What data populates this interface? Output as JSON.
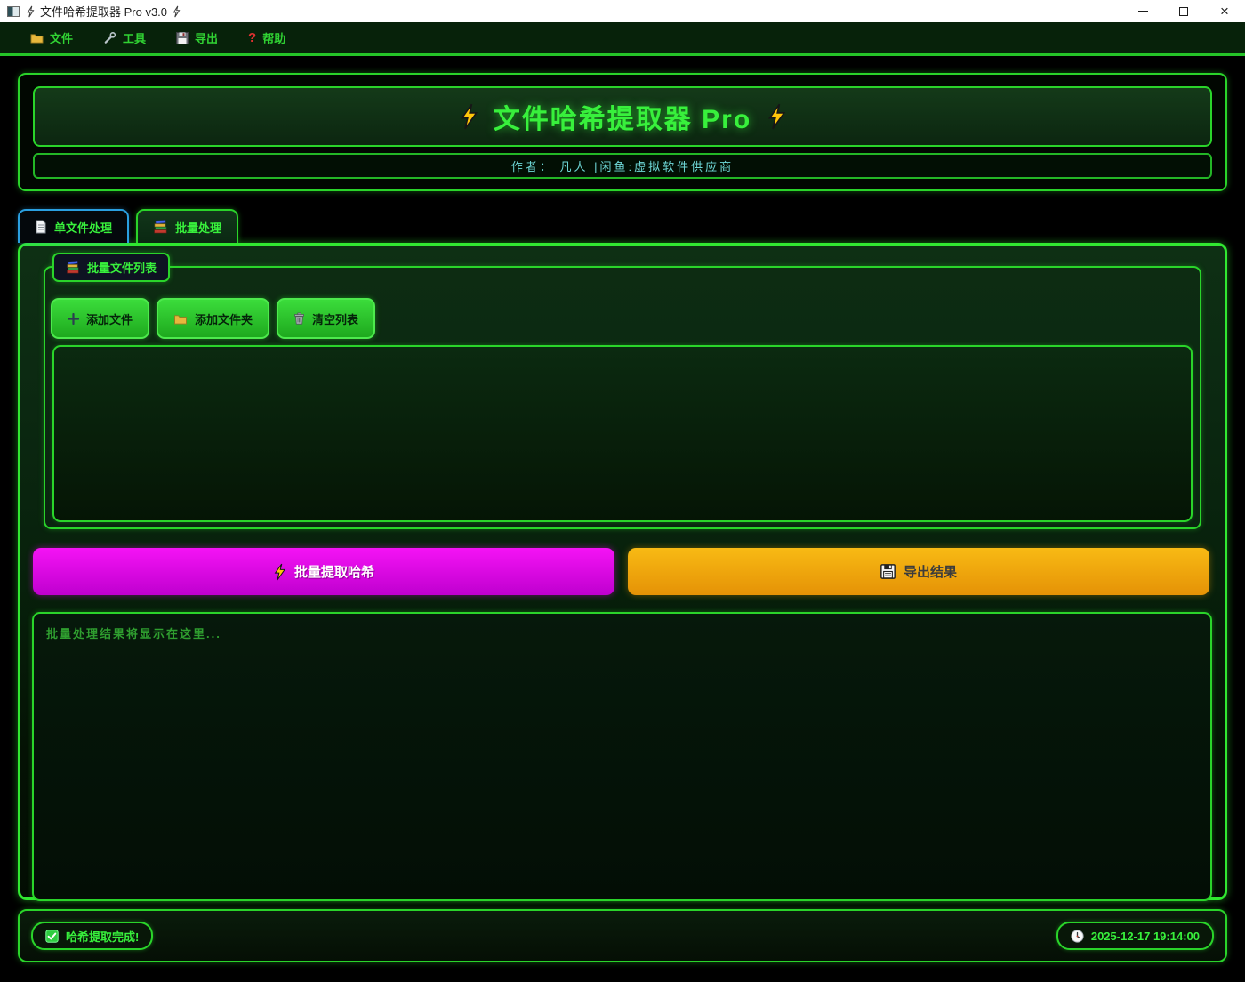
{
  "window": {
    "title": "文件哈希提取器 Pro v3.0",
    "close_glyph": "×"
  },
  "menu": {
    "items": [
      {
        "label": "文件",
        "icon": "folder-icon"
      },
      {
        "label": "工具",
        "icon": "wrench-icon"
      },
      {
        "label": "导出",
        "icon": "floppy-icon"
      },
      {
        "label": "帮助",
        "icon": "question-icon"
      }
    ],
    "help_icon_glyph": "?"
  },
  "header": {
    "title": "文件哈希提取器 Pro",
    "author_line": "作者： 凡人  |闲鱼:虚拟软件供应商"
  },
  "tabs": [
    {
      "label": "单文件处理",
      "icon": "document-icon",
      "active": false
    },
    {
      "label": "批量处理",
      "icon": "books-icon",
      "active": true
    }
  ],
  "batch": {
    "group_label": "批量文件列表",
    "toolbar": [
      {
        "label": "添加文件",
        "icon": "plus-icon"
      },
      {
        "label": "添加文件夹",
        "icon": "folder-icon"
      },
      {
        "label": "清空列表",
        "icon": "trash-icon"
      }
    ],
    "extract_label": "批量提取哈希",
    "export_label": "导出结果",
    "results_placeholder": "批量处理结果将显示在这里..."
  },
  "status_bar": {
    "status_text": "哈希提取完成!",
    "timestamp": "2025-12-17 19:14:00"
  },
  "colors": {
    "neon_green_border": "#2ad42a",
    "bright_green_text": "#38f03c",
    "inactive_tab_blue": "#2a9fe0",
    "author_cyan": "#6fd8d8",
    "extract_magenta": "#ee00ee",
    "export_orange": "#f2a300",
    "lightning_yellow": "#ffc60a",
    "titlebar_white": "#ffffff"
  }
}
